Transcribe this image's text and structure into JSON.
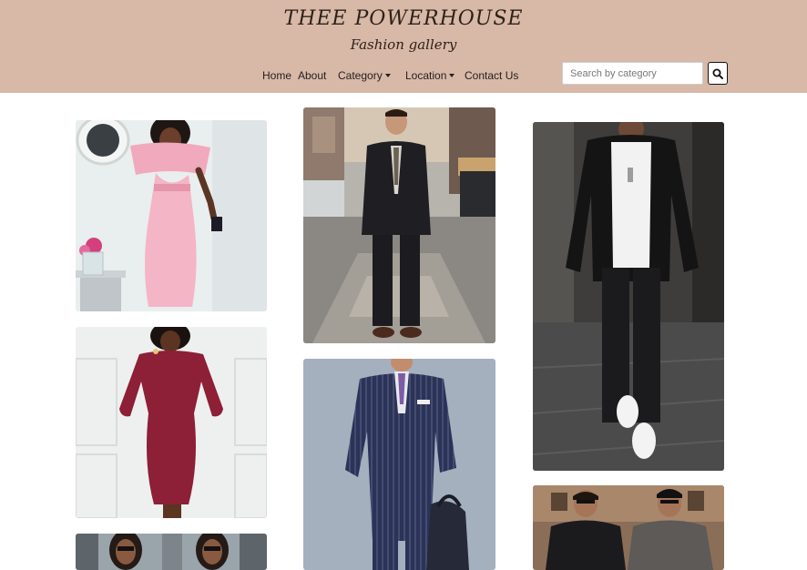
{
  "brand": {
    "title": "THEE POWERHOUSE",
    "subtitle": "Fashion gallery"
  },
  "nav": {
    "items": [
      {
        "label": "Home",
        "dropdown": false
      },
      {
        "label": "About",
        "dropdown": false
      },
      {
        "label": "Category",
        "dropdown": true
      },
      {
        "label": "Location",
        "dropdown": true
      },
      {
        "label": "Contact Us",
        "dropdown": false
      }
    ]
  },
  "search": {
    "placeholder": "Search by category",
    "value": "",
    "button_icon": "search-icon"
  },
  "colors": {
    "header_bg": "#d8b8a7",
    "title_text": "#2d2118"
  },
  "gallery": {
    "columns": [
      [
        "pink-dress",
        "burgundy-dress",
        "two-women-sunglasses"
      ],
      [
        "black-suit-man",
        "pinstripe-suit-man"
      ],
      [
        "leather-jacket-man",
        "two-men-winter-coats"
      ]
    ]
  }
}
